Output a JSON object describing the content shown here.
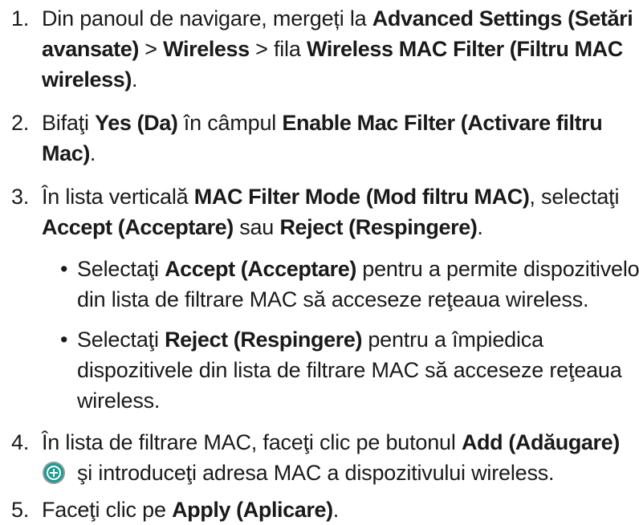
{
  "steps": [
    {
      "num": "1.",
      "l1a": "Din panoul de navigare, mergeți la ",
      "l1b": "Advanced Settings (Setări",
      "l2a": "avansate)",
      "l2b": " > ",
      "l2c": "Wireless",
      "l2d": " > fila ",
      "l2e": "Wireless MAC Filter (Filtru MAC",
      "l3a": "wireless)",
      "l3b": "."
    },
    {
      "num": "2.",
      "l1a": "Bifaţi ",
      "l1b": "Yes (Da)",
      "l1c": " în câmpul ",
      "l1d": "Enable Mac Filter (Activare filtru",
      "l2a": "Mac)",
      "l2b": "."
    },
    {
      "num": "3.",
      "l1a": "În lista verticală ",
      "l1b": "MAC Filter Mode (Mod filtru MAC)",
      "l1c": ", selectaţi",
      "l2a": "Accept (Acceptare)",
      "l2b": " sau ",
      "l2c": "Reject (Respingere)",
      "l2d": "."
    },
    {
      "num": "4.",
      "l1a": "În lista de filtrare MAC, faceţi clic pe butonul ",
      "l1b": "Add (Adăugare)",
      "l2a": "şi introduceţi adresa MAC a dispozitivului wireless."
    },
    {
      "num": "5.",
      "l1a": "Faceţi clic pe ",
      "l1b": "Apply (Aplicare)",
      "l1c": "."
    }
  ],
  "bullets": [
    {
      "symbol": "•",
      "l1a": "Selectaţi ",
      "l1b": "Accept (Acceptare)",
      "l1c": " pentru a permite dispozitivelor",
      "l2": "din lista de filtrare MAC să acceseze reţeaua wireless."
    },
    {
      "symbol": "•",
      "l1a": "Selectaţi ",
      "l1b": "Reject (Respingere)",
      "l1c": " pentru a împiedica",
      "l2": "dispozitivele din lista de filtrare MAC să acceseze reţeaua",
      "l3": "wireless."
    }
  ],
  "icons": {
    "add": "add-circle-icon"
  },
  "colors": {
    "text": "#1a1a1a",
    "icon_teal": "#1d9a8f",
    "icon_ring": "#7a8a8c"
  }
}
